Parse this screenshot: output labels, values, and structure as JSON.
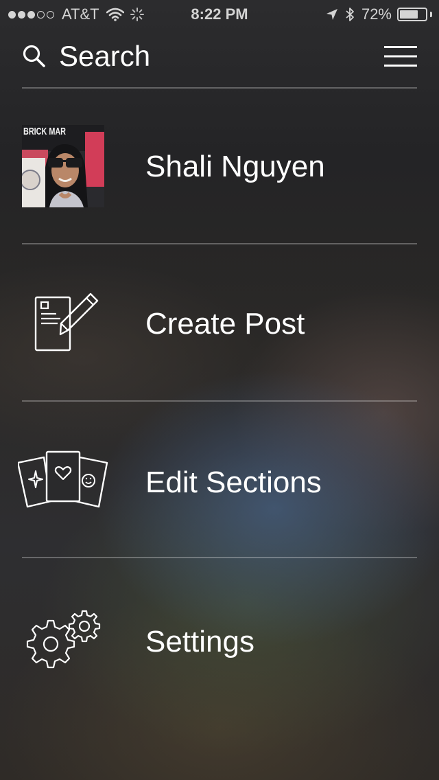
{
  "status_bar": {
    "carrier": "AT&T",
    "signal_bars_filled": 3,
    "signal_bars_total": 5,
    "time": "8:22 PM",
    "battery_percent": "72%",
    "battery_level": 0.72
  },
  "header": {
    "search_label": "Search"
  },
  "menu": {
    "items": [
      {
        "label": "Shali Nguyen",
        "icon": "avatar"
      },
      {
        "label": "Create Post",
        "icon": "compose-icon"
      },
      {
        "label": "Edit Sections",
        "icon": "cards-icon"
      },
      {
        "label": "Settings",
        "icon": "gears-icon"
      }
    ]
  },
  "avatar_image": {
    "sign_text": "BRICK MAR"
  }
}
